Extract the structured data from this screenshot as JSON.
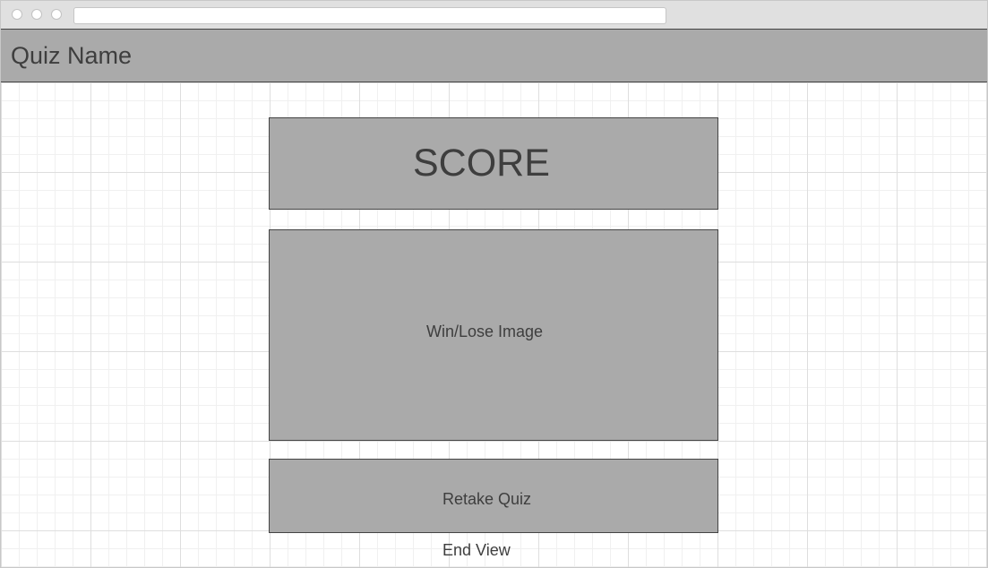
{
  "header": {
    "title": "Quiz Name"
  },
  "score": {
    "label": "SCORE"
  },
  "result_image": {
    "placeholder": "Win/Lose Image"
  },
  "actions": {
    "retake_label": "Retake Quiz"
  },
  "view": {
    "caption": "End View"
  },
  "colors": {
    "block_fill": "#aaaaaa",
    "block_border": "#444444",
    "text": "#3e3e3e",
    "titlebar": "#e0e0e0",
    "grid": "#dedede"
  }
}
